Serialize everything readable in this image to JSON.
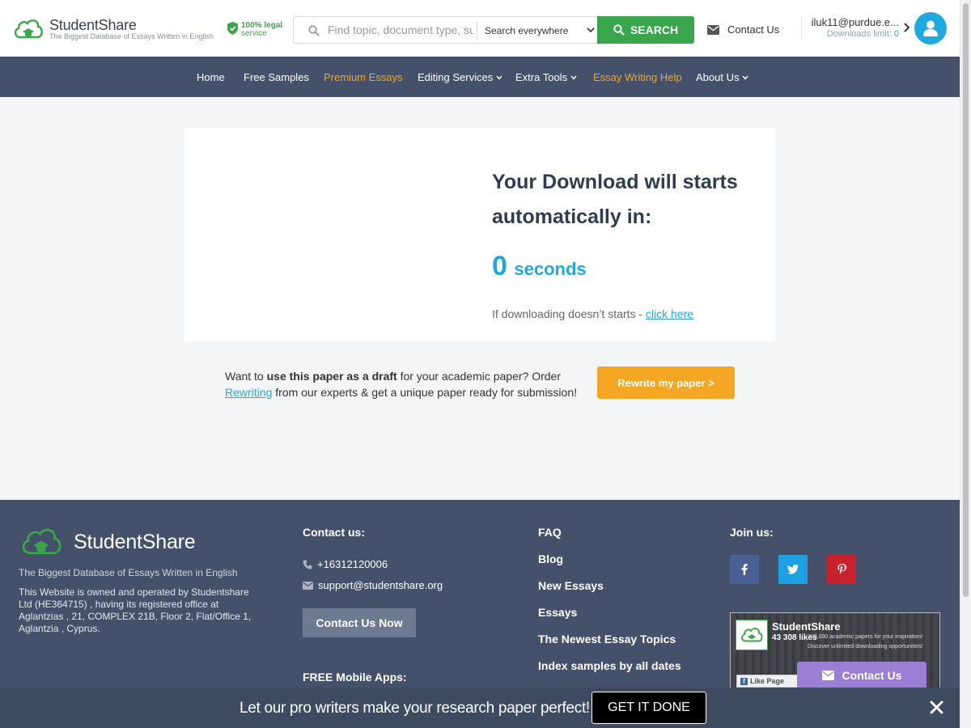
{
  "header": {
    "logo_name": "StudentShare",
    "logo_tagline": "The Biggest Database of Essays Written in English",
    "legal_line1": "100% legal",
    "legal_line2": "service",
    "search_placeholder": "Find topic, document type, su",
    "search_scope": "Search everywhere",
    "search_button": "SEARCH",
    "contact_label": "Contact Us",
    "user_email": "iluk11@purdue.e...",
    "downloads_label": "Downloads limit:",
    "downloads_value": "0"
  },
  "nav": {
    "items": [
      {
        "label": "Home"
      },
      {
        "label": "Free Samples"
      },
      {
        "label": "Premium Essays"
      },
      {
        "label": "Editing Services"
      },
      {
        "label": "Extra Tools"
      },
      {
        "label": "Essay Writing Help"
      },
      {
        "label": "About Us"
      }
    ]
  },
  "main": {
    "download_title": "Your Download will starts automatically in:",
    "countdown_value": "0",
    "countdown_unit": "seconds",
    "fallback_text": "If downloading doesn’t starts - ",
    "fallback_link": "click here",
    "promo_pre": "Want to ",
    "promo_bold": "use this paper as a draft",
    "promo_mid": " for your academic paper? Order ",
    "promo_link": "Rewriting",
    "promo_post": " from our experts & get a unique paper ready for submission!",
    "rewrite_button": "Rewrite my paper >"
  },
  "footer": {
    "logo_name": "StudentShare",
    "tagline": "The Biggest Database of Essays Written in English",
    "about": "This Website is owned and operated by Studentshare Ltd (HE364715) , having its registered office at Aglantzias , 21, COMPLEX 21B, Floor 2, Flat/Office 1, Aglantzia , Cyprus.",
    "contact_heading": "Contact us:",
    "phone": "+16312120006",
    "email": "support@studentshare.org",
    "contact_button": "Contact Us Now",
    "apps_heading": "FREE Mobile Apps:",
    "links": [
      "FAQ",
      "Blog",
      "New Essays",
      "Essays",
      "The Newest Essay Topics",
      "Index samples by all dates"
    ],
    "join_heading": "Join us:",
    "social": [
      {
        "icon": "facebook-icon",
        "color": "#4a5f94"
      },
      {
        "icon": "twitter-icon",
        "color": "#1da1e2"
      },
      {
        "icon": "pinterest-icon",
        "color": "#c8232c"
      }
    ],
    "fb_widget": {
      "name": "StudentShare",
      "likes": "43 308 likes",
      "desc1": "300,000 academic papers for your inspiration!",
      "desc2": "Discover unlimited downloading opportunities!",
      "like_button": "Like Page"
    }
  },
  "float_contact": "Contact Us",
  "banner": {
    "text": "Let our pro writers make your research paper perfect!",
    "button": "GET IT DONE"
  },
  "colors": {
    "brand_green": "#3aa64b",
    "accent_blue": "#1fa9e1",
    "accent_orange": "#f5a623",
    "nav_bg": "#45516a"
  }
}
